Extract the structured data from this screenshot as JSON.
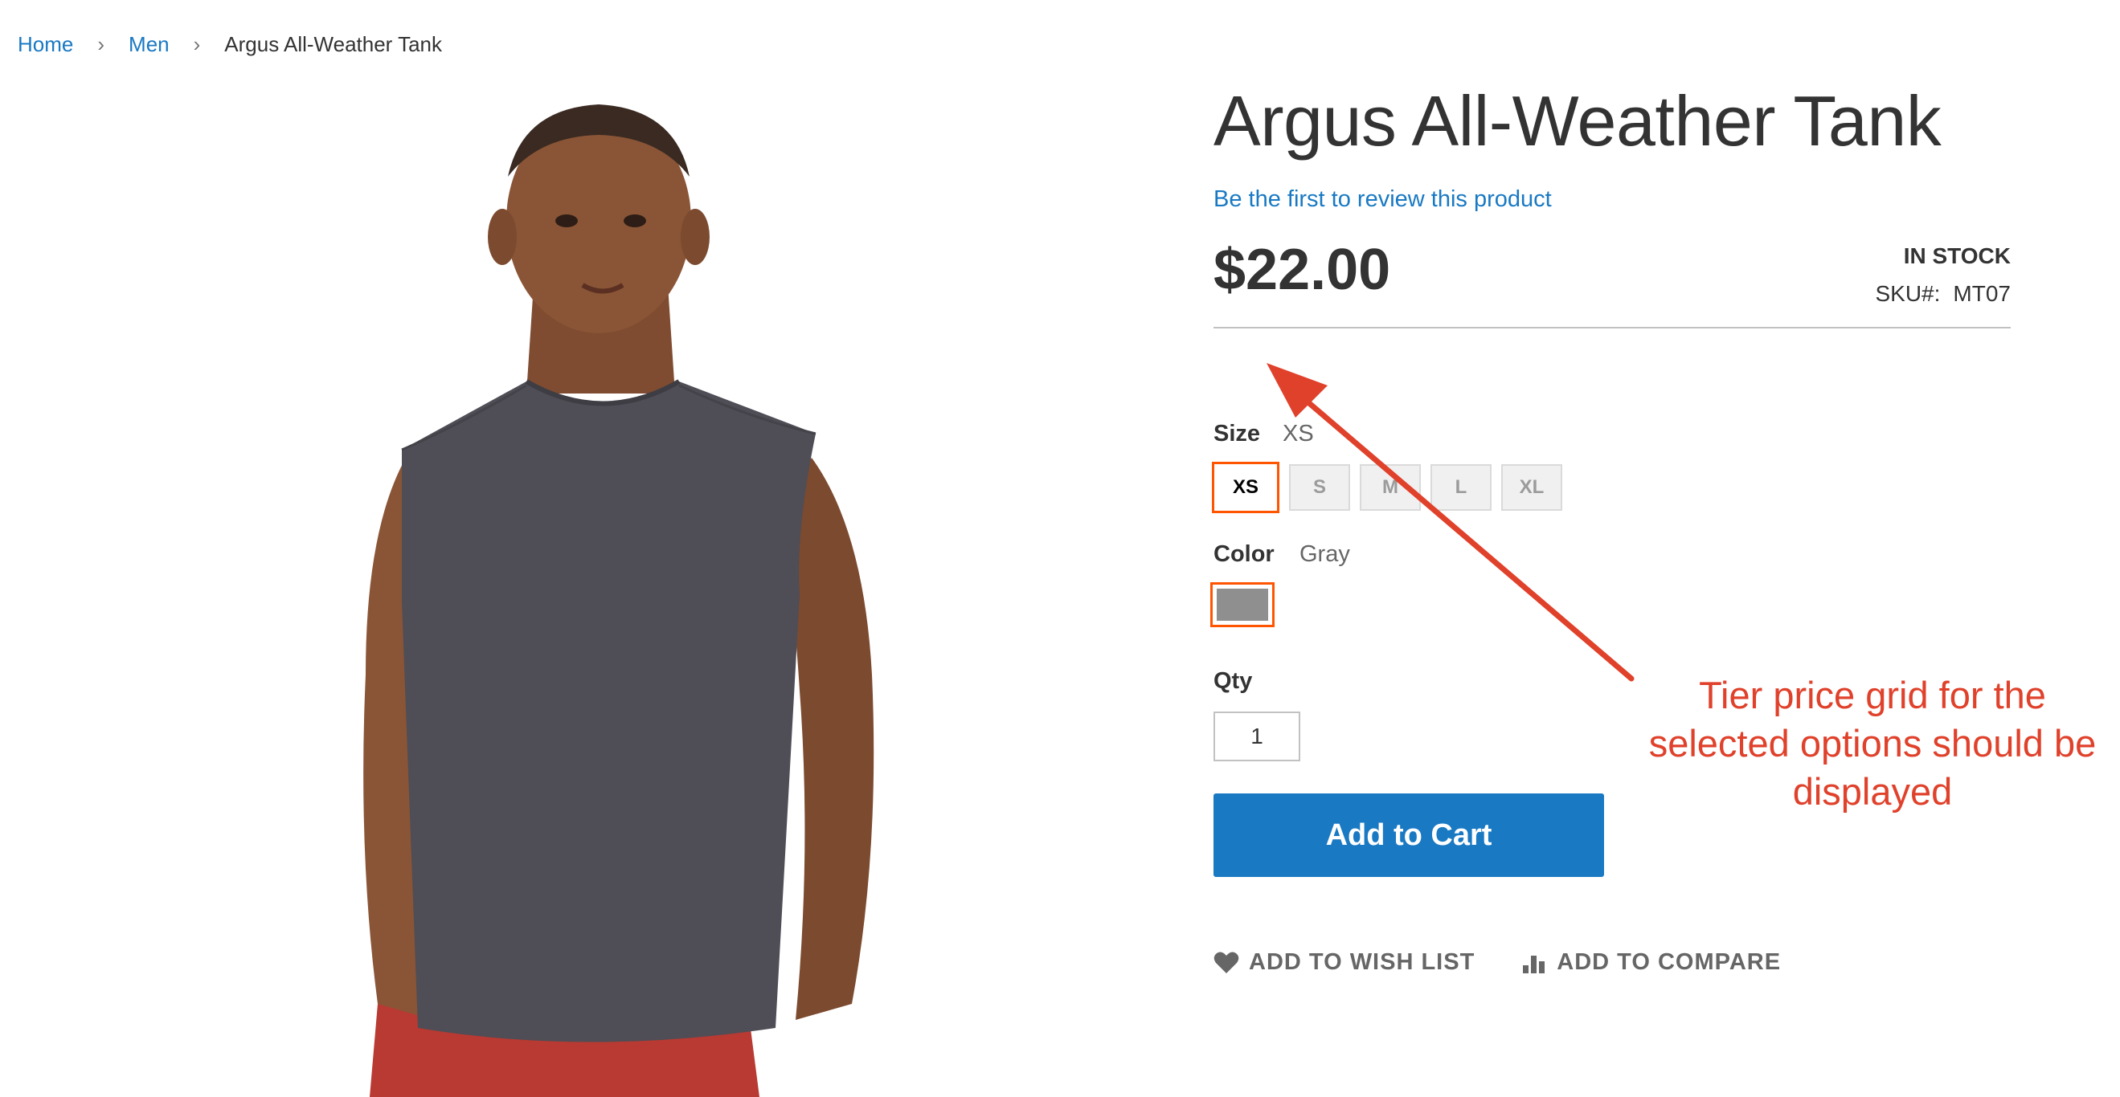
{
  "breadcrumb": {
    "home": "Home",
    "category": "Men",
    "current": "Argus All-Weather Tank",
    "separator": "›"
  },
  "product": {
    "title": "Argus All-Weather Tank",
    "review_link": "Be the first to review this product",
    "price": "$22.00",
    "stock": "IN STOCK",
    "sku_label": "SKU#:",
    "sku_value": "MT07"
  },
  "options": {
    "size": {
      "label": "Size",
      "selected": "XS",
      "values": [
        "XS",
        "S",
        "M",
        "L",
        "XL"
      ]
    },
    "color": {
      "label": "Color",
      "selected": "Gray",
      "swatch_color": "#8f8f8f"
    }
  },
  "qty": {
    "label": "Qty",
    "value": "1"
  },
  "buttons": {
    "add_to_cart": "Add to Cart",
    "wish_list": "ADD TO WISH LIST",
    "compare": "ADD TO COMPARE"
  },
  "annotation": {
    "text": "Tier price grid for the\nselected options should be\ndisplayed",
    "color": "#e0412b"
  },
  "colors": {
    "link": "#1979c3",
    "accent_border": "#ff5501",
    "shirt": "#4f4d55",
    "shorts": "#b83a32",
    "skin": "#8a5536"
  }
}
